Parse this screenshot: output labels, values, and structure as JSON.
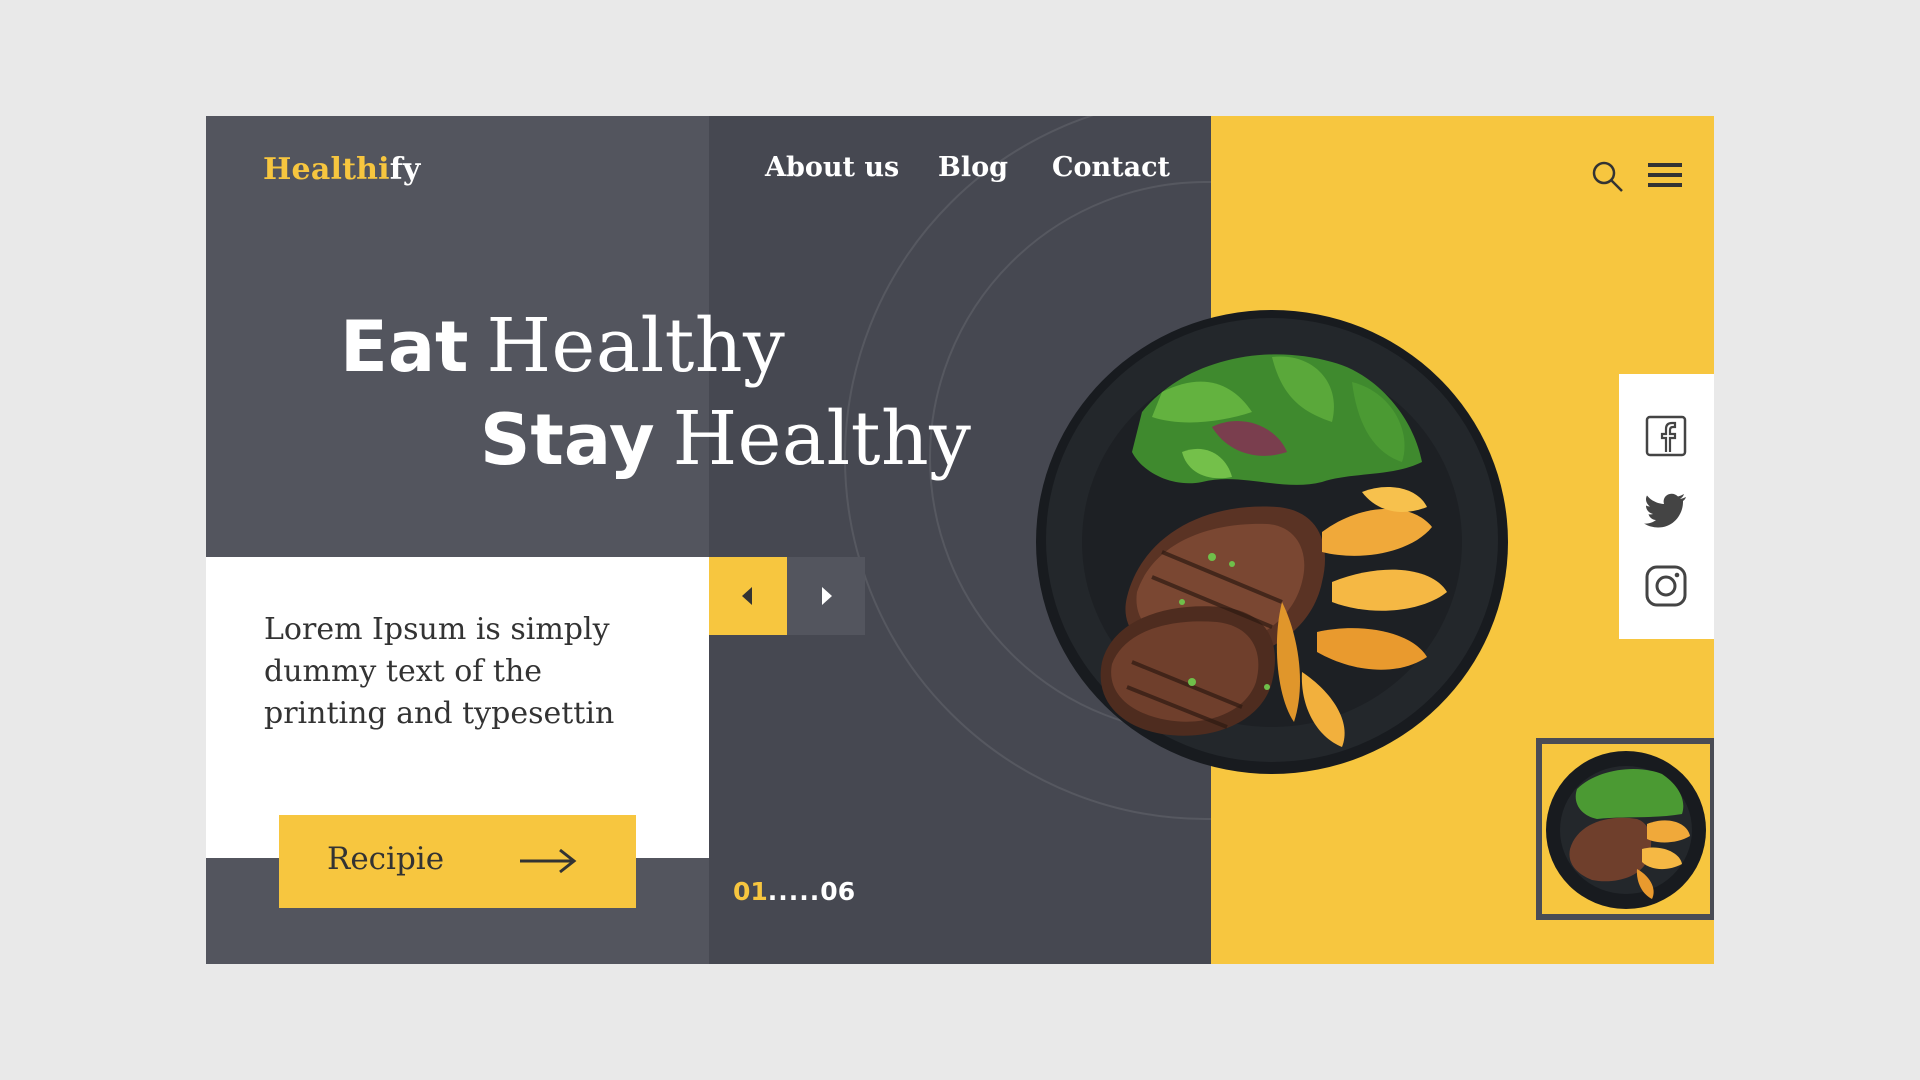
{
  "brand": {
    "part1": "Healthi",
    "part2": "fy"
  },
  "nav": {
    "about": "About us",
    "blog": "Blog",
    "contact": "Contact"
  },
  "hero": {
    "line1_bold": "Eat",
    "line1_light": "Healthy",
    "line2_bold": "Stay",
    "line2_light": "Healthy"
  },
  "description": "Lorem Ipsum is simply dummy text of the printing and typesettin",
  "cta": {
    "label": "Recipie"
  },
  "pager": {
    "current": "01",
    "dots": ".....",
    "total": "06"
  },
  "icons": {
    "search": "search-icon",
    "menu": "hamburger-menu-icon",
    "prev": "caret-left-icon",
    "next": "caret-right-icon",
    "cta_arrow": "arrow-right-icon",
    "facebook": "facebook-icon",
    "twitter": "twitter-icon",
    "instagram": "instagram-icon"
  },
  "colors": {
    "accent": "#f7c63f",
    "dark": "#464851",
    "dark_alt": "#53555e",
    "white": "#ffffff",
    "text": "#333333"
  }
}
